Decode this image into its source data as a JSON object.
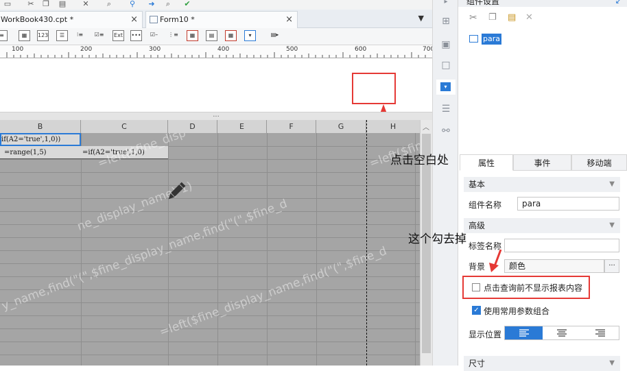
{
  "tabs": [
    {
      "label": "WorkBook430.cpt *",
      "close": "×"
    },
    {
      "label": "Form10 *",
      "close": "×"
    }
  ],
  "ruler_ticks": [
    "100",
    "200",
    "300",
    "400",
    "500",
    "600",
    "700"
  ],
  "splitter_handle": "...",
  "sheet": {
    "columns": [
      "B",
      "C",
      "D",
      "E",
      "F",
      "G",
      "H"
    ],
    "cells": {
      "b1": "if(A2='true',1,0))",
      "b2": "=range(1,5)",
      "c2": "=if(A2='true',1,0)"
    },
    "watermarks": [
      "=left($fine_disp",
      "ne_display_name)-1)",
      "y_name,find(\"(\",$fine_display_name,find(\"(\",$fine_d",
      "=left($fine_display_name,find(\"(\",$fine_d",
      "=left($fin"
    ]
  },
  "right_panel": {
    "header_title": "组件设置",
    "tree_item": "para",
    "tabs": [
      "属性",
      "事件",
      "移动端"
    ],
    "section_basic": "基本",
    "component_name_label": "组件名称",
    "component_name_value": "para",
    "section_advanced": "高级",
    "tag_name_label": "标签名称",
    "tag_name_value": "",
    "background_label": "背景",
    "background_value": "颜色",
    "more_button": "···",
    "checkbox_no_report_label": "点击查询前不显示报表内容",
    "checkbox_no_report_checked": false,
    "checkbox_common_params_label": "使用常用参数组合",
    "checkbox_common_params_checked": true,
    "display_position_label": "显示位置",
    "section_size": "尺寸"
  },
  "annotations": {
    "click_blank": "点击空白处",
    "uncheck_this": "这个勾去掉"
  },
  "colors": {
    "annotation_red": "#e53935",
    "selected_blue": "#2a7ad6",
    "grid_gray": "#a5a5a5"
  }
}
